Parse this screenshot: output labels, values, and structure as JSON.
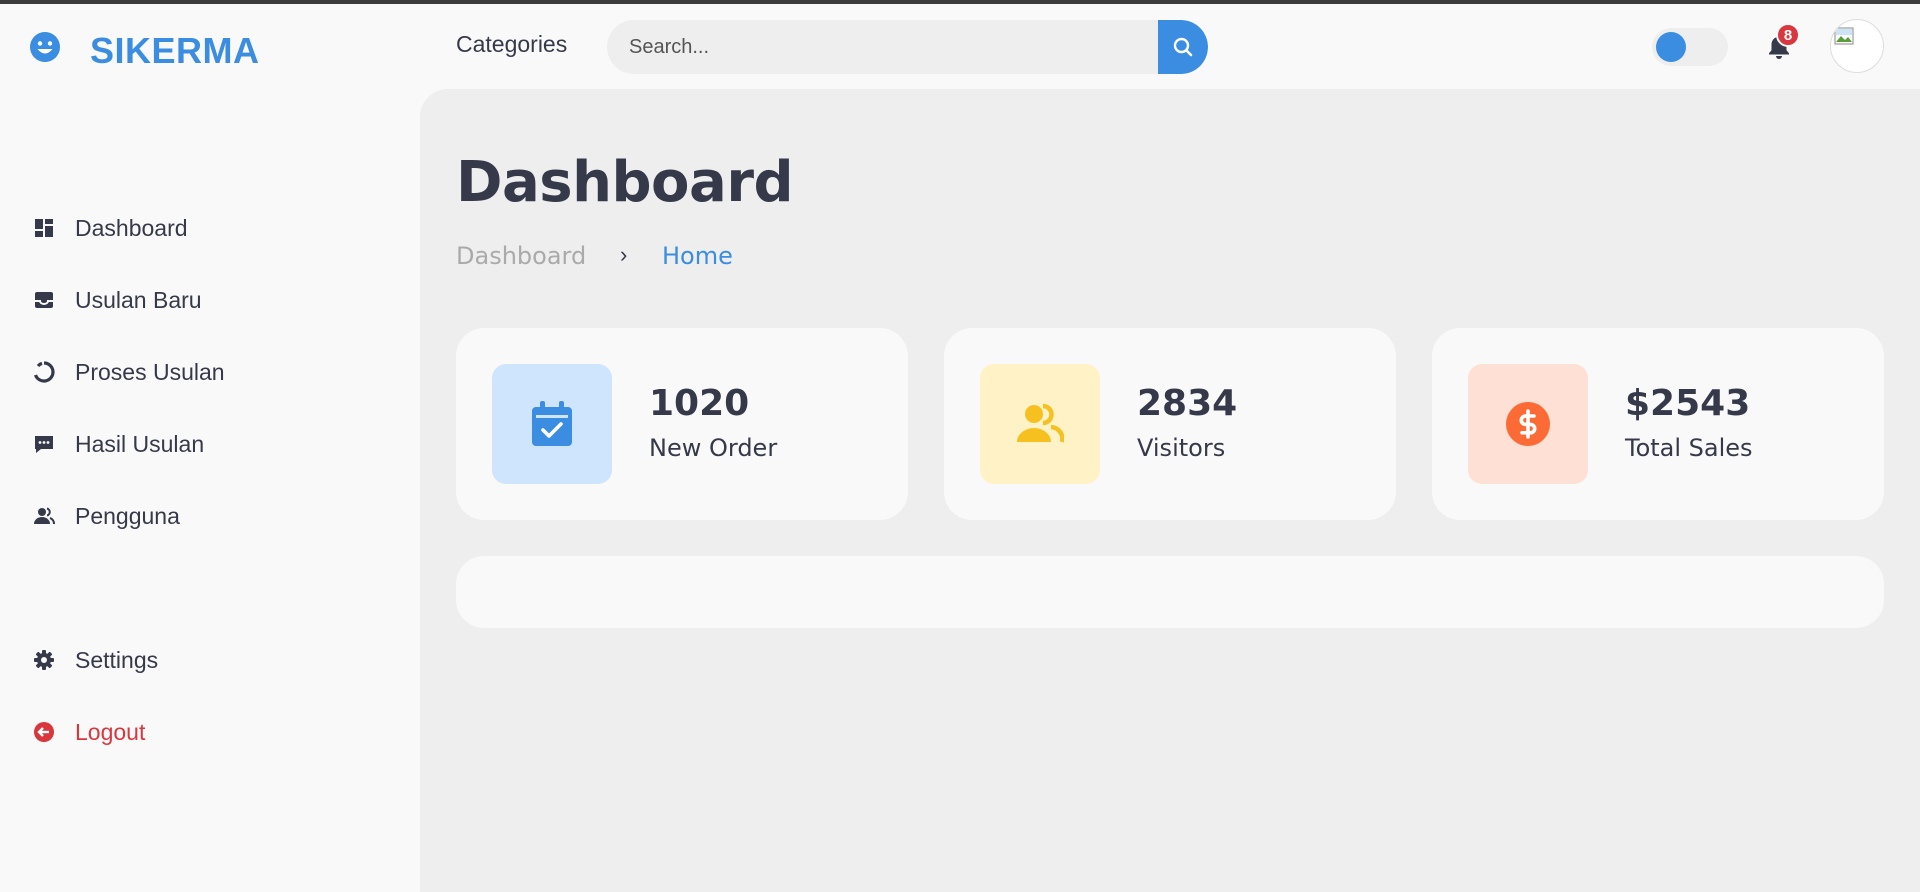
{
  "brand": {
    "name": "SIKERMA",
    "icon": "smiley-icon",
    "color": "#3a8de0"
  },
  "sidebar": {
    "items": [
      {
        "label": "Dashboard",
        "icon": "dashboard-icon"
      },
      {
        "label": "Usulan Baru",
        "icon": "inbox-icon"
      },
      {
        "label": "Proses Usulan",
        "icon": "loading-circle-icon"
      },
      {
        "label": "Hasil Usulan",
        "icon": "message-icon"
      },
      {
        "label": "Pengguna",
        "icon": "users-icon"
      }
    ],
    "settings": {
      "label": "Settings",
      "icon": "gear-icon"
    },
    "logout": {
      "label": "Logout",
      "icon": "logout-icon",
      "color": "#d9363e"
    }
  },
  "topbar": {
    "categories_label": "Categories",
    "search": {
      "placeholder": "Search...",
      "value": ""
    },
    "notifications": {
      "count": "8"
    },
    "theme_toggle": {
      "state": "light"
    }
  },
  "main": {
    "title": "Dashboard",
    "breadcrumb": {
      "parent": "Dashboard",
      "separator": "›",
      "current": "Home"
    },
    "cards": [
      {
        "value": "1020",
        "label": "New Order",
        "icon": "calendar-check-icon",
        "icon_color": "#3a8de0",
        "bg_color": "#cfe5fe"
      },
      {
        "value": "2834",
        "label": "Visitors",
        "icon": "group-icon",
        "icon_color": "#f6c120",
        "bg_color": "#fff2c6"
      },
      {
        "value": "$2543",
        "label": "Total Sales",
        "icon": "dollar-circle-icon",
        "icon_color": "#fc6b36",
        "bg_color": "#ffe0d4"
      }
    ]
  }
}
